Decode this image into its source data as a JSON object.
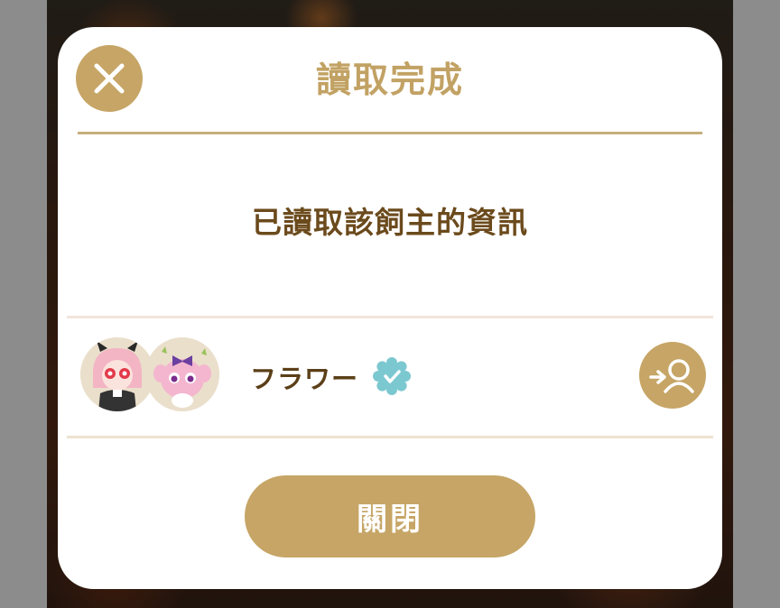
{
  "dialog": {
    "title": "讀取完成",
    "message": "已讀取該飼主的資訊",
    "close_button_label": "關閉"
  },
  "owner": {
    "name": "フラワー",
    "avatars": [
      "devil-girl-avatar",
      "pink-creature-avatar"
    ],
    "badge": "verified-badge-icon"
  },
  "colors": {
    "accent_gold": "#c6a566",
    "title_gold": "#c2a264",
    "message_brown": "#6b4a1c",
    "badge_teal": "#7cc8d1"
  }
}
